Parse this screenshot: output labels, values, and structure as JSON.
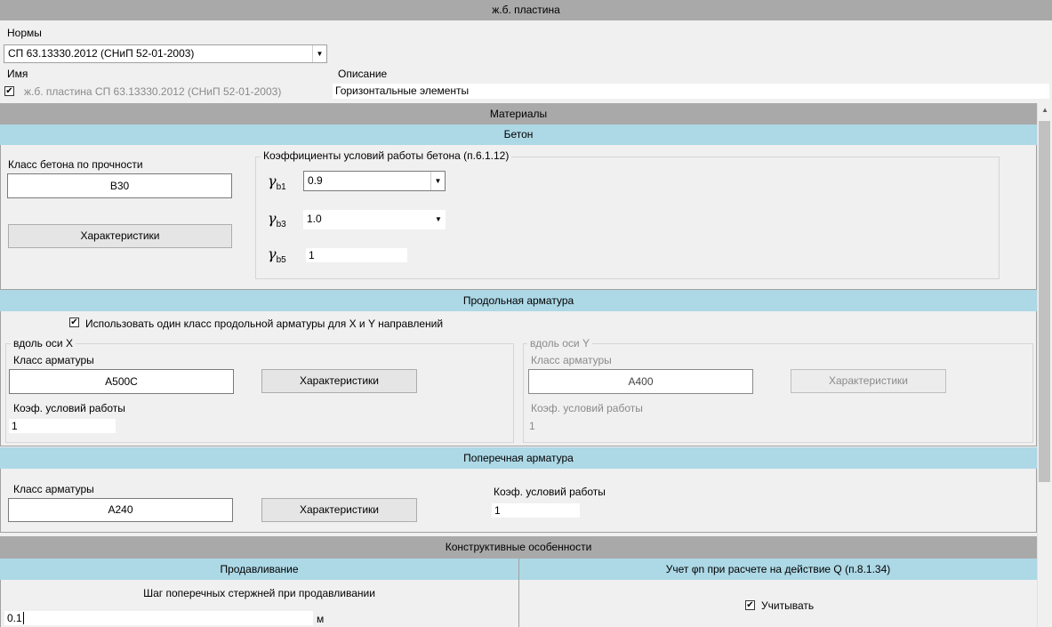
{
  "window": {
    "title": "ж.б. пластина"
  },
  "norms": {
    "label": "Нормы",
    "selected": "СП 63.13330.2012 (СНиП 52-01-2003)"
  },
  "header": {
    "name_label": "Имя",
    "description_label": "Описание",
    "name_value": "ж.б. пластина СП 63.13330.2012 (СНиП 52-01-2003)",
    "description_value": "Горизонтальные элементы"
  },
  "materials": {
    "title": "Материалы"
  },
  "concrete": {
    "title": "Бетон",
    "class_label": "Класс бетона по прочности",
    "class_value": "B30",
    "characteristics_button": "Характеристики",
    "coeff_group_title": "Коэффициенты условий работы бетона (п.6.1.12)",
    "gamma_symbol": "γ",
    "gb1_sub": "b1",
    "gb1_value": "0.9",
    "gb3_sub": "b3",
    "gb3_value": "1.0",
    "gb5_sub": "b5",
    "gb5_value": "1"
  },
  "longitudinal": {
    "title": "Продольная арматура",
    "use_single_class_label": "Использовать один класс продольной арматуры для X и Y направлений",
    "use_single_class_checked": true,
    "x": {
      "group_title": "вдоль оси X",
      "class_label": "Класс арматуры",
      "class_value": "A500C",
      "characteristics_button": "Характеристики",
      "coeff_label": "Коэф. условий работы",
      "coeff_value": "1"
    },
    "y": {
      "group_title": "вдоль оси Y",
      "class_label": "Класс арматуры",
      "class_value": "A400",
      "characteristics_button": "Характеристики",
      "coeff_label": "Коэф. условий работы",
      "coeff_value": "1"
    }
  },
  "transverse": {
    "title": "Поперечная арматура",
    "class_label": "Класс арматуры",
    "class_value": "A240",
    "characteristics_button": "Характеристики",
    "coeff_label": "Коэф. условий работы",
    "coeff_value": "1"
  },
  "constructive": {
    "title": "Конструктивные особенности",
    "punching_title": "Продавливание",
    "phi_title": "Учет φn при расчете на действие Q (п.8.1.34)",
    "step_label": "Шаг поперечных стержней при продавливании",
    "step_value": "0.1",
    "step_unit": "м",
    "consider_label": "Учитывать",
    "consider_checked": true
  },
  "colors": {
    "section_gray": "#a9a9a9",
    "section_blue": "#add8e6"
  }
}
